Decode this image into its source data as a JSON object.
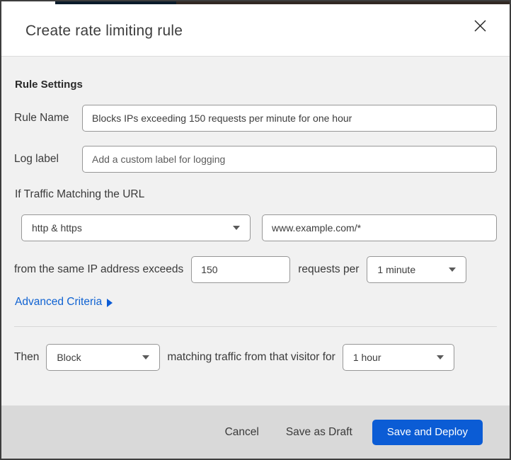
{
  "dialog": {
    "title": "Create rate limiting rule"
  },
  "rule_settings": {
    "heading": "Rule Settings",
    "rule_name": {
      "label": "Rule Name",
      "value": "Blocks IPs exceeding 150 requests per minute for one hour"
    },
    "log_label": {
      "label": "Log label",
      "placeholder": "Add a custom label for logging"
    }
  },
  "match": {
    "heading": "If Traffic Matching the URL",
    "scheme_select": {
      "value": "http & https"
    },
    "url_input": {
      "value": "www.example.com/*"
    },
    "exceeds_label": "from the same IP address exceeds",
    "requests_value": "150",
    "requests_per_label": "requests per",
    "period_select": {
      "value": "1 minute"
    },
    "advanced_link_label": "Advanced Criteria"
  },
  "action": {
    "then_label": "Then",
    "action_select": {
      "value": "Block"
    },
    "duration_label": "matching traffic from that visitor for",
    "duration_select": {
      "value": "1 hour"
    }
  },
  "footer": {
    "cancel_label": "Cancel",
    "save_draft_label": "Save as Draft",
    "save_deploy_label": "Save and Deploy"
  },
  "colors": {
    "primary_blue": "#0b5cd5",
    "link_blue": "#0f62d2",
    "body_bg": "#f1f1f1",
    "footer_bg": "#d9d9d9"
  }
}
